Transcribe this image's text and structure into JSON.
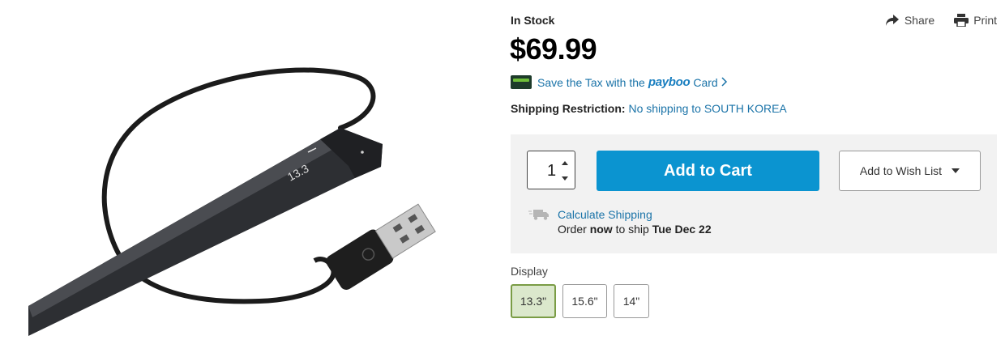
{
  "product": {
    "stock_status": "In Stock",
    "price": "$69.99",
    "display_badge": "13.3"
  },
  "tools": {
    "share_label": "Share",
    "print_label": "Print"
  },
  "payboo": {
    "text": "Save the Tax with the",
    "logo": "payboo",
    "card": "Card"
  },
  "shipping_restriction": {
    "label": "Shipping Restriction:",
    "value": "No shipping to SOUTH KOREA"
  },
  "cart": {
    "quantity": "1",
    "add_label": "Add to Cart",
    "wishlist_label": "Add to Wish List",
    "calc_shipping": "Calculate Shipping",
    "order_prefix": "Order",
    "order_now": "now",
    "order_mid": "to ship",
    "ship_date": "Tue Dec 22"
  },
  "display": {
    "label": "Display",
    "options": [
      "13.3\"",
      "15.6\"",
      "14\""
    ],
    "selected": "13.3\""
  },
  "colors": {
    "accent": "#0b94d0",
    "link": "#1a73a8",
    "selected_bg": "#dbe8cc",
    "selected_border": "#7a9c45"
  }
}
